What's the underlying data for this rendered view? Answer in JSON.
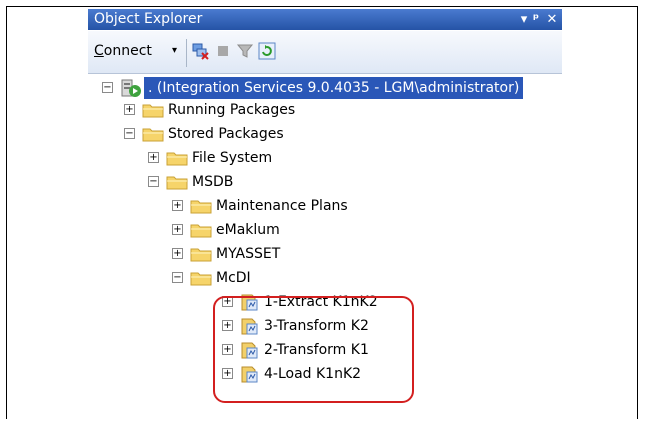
{
  "window": {
    "title": "Object Explorer",
    "pin_glyph": "▾ ⊥",
    "close_glyph": "✕"
  },
  "toolbar": {
    "connect_label": "Connect",
    "connect_access_key": "C",
    "connect_rest": "onnect",
    "caret": "▾"
  },
  "tree": {
    "root": ". (Integration Services 9.0.4035 - LGM\\administrator)",
    "running": "Running Packages",
    "stored": "Stored Packages",
    "file_system": "File System",
    "msdb": "MSDB",
    "maintenance": "Maintenance Plans",
    "emaklum": "eMaklum",
    "myasset": "MYASSET",
    "mcdi": "McDI",
    "packages": [
      "1-Extract K1nK2",
      "3-Transform K2",
      "2-Transform K1",
      "4-Load K1nK2"
    ]
  },
  "expander": {
    "plus": "+",
    "minus": "−"
  },
  "colors": {
    "highlight": "#d31f1f",
    "selection": "#2a57b8"
  }
}
